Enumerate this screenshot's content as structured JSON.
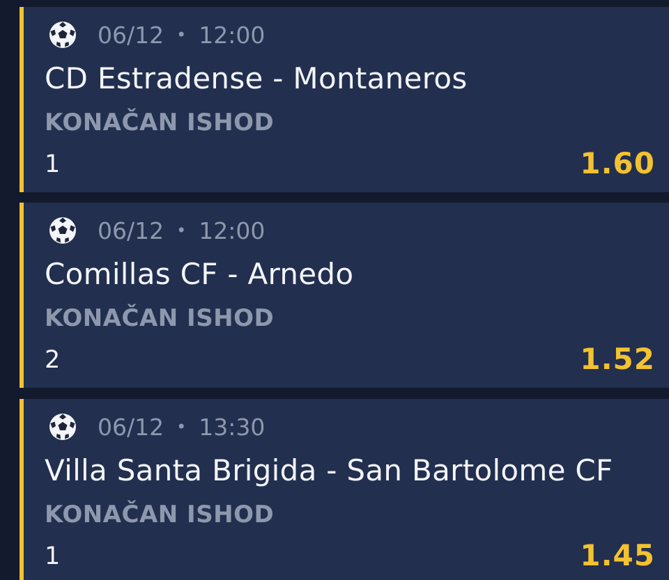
{
  "bets": [
    {
      "sport_icon": "soccer-ball-icon",
      "date": "06/12",
      "separator": "•",
      "time": "12:00",
      "match": "CD Estradense - Montaneros",
      "market": "KONAČAN ISHOD",
      "selection": "1",
      "odds": "1.60"
    },
    {
      "sport_icon": "soccer-ball-icon",
      "date": "06/12",
      "separator": "•",
      "time": "12:00",
      "match": "Comillas CF - Arnedo",
      "market": "KONAČAN ISHOD",
      "selection": "2",
      "odds": "1.52"
    },
    {
      "sport_icon": "soccer-ball-icon",
      "date": "06/12",
      "separator": "•",
      "time": "13:30",
      "match": "Villa Santa Brigida - San Bartolome CF",
      "market": "KONAČAN ISHOD",
      "selection": "1",
      "odds": "1.45"
    }
  ],
  "colors": {
    "background": "#131a2e",
    "card": "#222f4f",
    "accent": "#f2c230",
    "text_primary": "#f3f5fa",
    "text_secondary": "#8e98ad"
  }
}
